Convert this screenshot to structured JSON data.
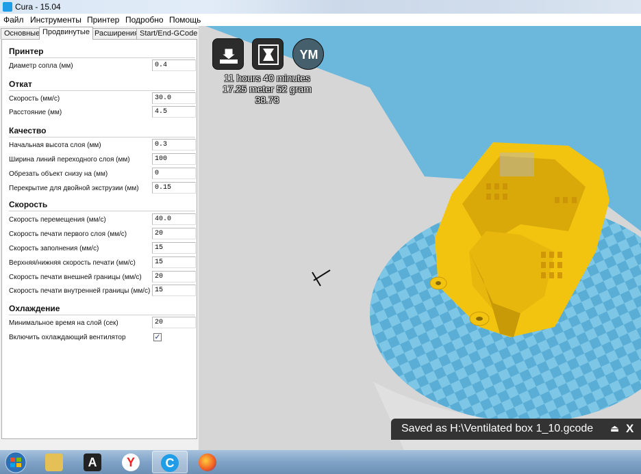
{
  "window": {
    "title": "Cura - 15.04"
  },
  "menu": [
    "Файл",
    "Инструменты",
    "Принтер",
    "Подробно",
    "Помощь"
  ],
  "tabs": [
    {
      "label": "Основные",
      "active": false
    },
    {
      "label": "Продвинутые",
      "active": true
    },
    {
      "label": "Расширения",
      "active": false
    },
    {
      "label": "Start/End-GCode",
      "active": false
    }
  ],
  "sections": {
    "printer": {
      "title": "Принтер",
      "rows": [
        {
          "label": "Диаметр сопла (мм)",
          "value": "0.4"
        }
      ]
    },
    "retraction": {
      "title": "Откат",
      "rows": [
        {
          "label": "Скорость (мм/с)",
          "value": "30.0"
        },
        {
          "label": "Расстояние (мм)",
          "value": "4.5"
        }
      ]
    },
    "quality": {
      "title": "Качество",
      "rows": [
        {
          "label": "Начальная высота слоя (мм)",
          "value": "0.3"
        },
        {
          "label": "Ширина линий переходного слоя (мм)",
          "value": "100"
        },
        {
          "label": "Обрезать объект снизу на (мм)",
          "value": "0"
        },
        {
          "label": "Перекрытие для двойной экструзии (мм)",
          "value": "0.15"
        }
      ]
    },
    "speed": {
      "title": "Скорость",
      "rows": [
        {
          "label": "Скорость перемещения (мм/с)",
          "value": "40.0"
        },
        {
          "label": "Скорость печати первого слоя (мм/с)",
          "value": "20"
        },
        {
          "label": "Скорость заполнения (мм/с)",
          "value": "15"
        },
        {
          "label": "Верхняя/нижняя скорость печати (мм/с)",
          "value": "15"
        },
        {
          "label": "Скорость печати внешней границы (мм/с)",
          "value": "20"
        },
        {
          "label": "Скорость печати внутренней границы (мм/с)",
          "value": "15"
        }
      ]
    },
    "cooling": {
      "title": "Охлаждение",
      "rows": [
        {
          "label": "Минимальное время на слой (сек)",
          "value": "20"
        }
      ],
      "fan": {
        "label": "Включить охлаждающий вентилятор",
        "checked": true
      }
    }
  },
  "viewport": {
    "buttons": [
      {
        "icon": "load-model-icon"
      },
      {
        "icon": "print-save-icon"
      },
      {
        "icon": "ym-icon",
        "text": "YM"
      }
    ],
    "print_info": {
      "time": "11 hours 40 minutes",
      "material": "17.25 meter 52 gram",
      "cost": "38.78"
    },
    "save_notice": {
      "text": "Saved as H:\\Ventilated box 1_10.gcode",
      "close": "X"
    },
    "colors": {
      "model": "#f2c40f",
      "platform": "#5fb2d6",
      "background": "#d6d6d6"
    }
  },
  "taskbar": {
    "items": [
      {
        "name": "start-button",
        "icon": "windows-icon"
      },
      {
        "name": "explorer",
        "icon": "folder-icon"
      },
      {
        "name": "app-a",
        "icon": "a-icon",
        "text": "A"
      },
      {
        "name": "yandex-browser",
        "icon": "yandex-icon",
        "text": "Y"
      },
      {
        "name": "cura",
        "icon": "cura-icon",
        "text": "C",
        "active": true
      },
      {
        "name": "firefox",
        "icon": "firefox-icon"
      }
    ]
  }
}
